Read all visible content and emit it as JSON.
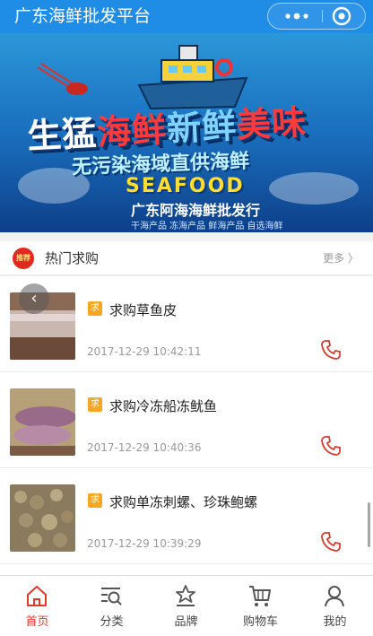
{
  "header": {
    "title": "广东海鲜批发平台"
  },
  "banner": {
    "line1_white": "生猛",
    "line1_red": "海鲜",
    "line1_blue": "新鲜",
    "line1_red2": "美味",
    "line2": "无污染海域直供海鲜",
    "seafood": "SEAFOOD",
    "company": "广东阿海海鲜批发行",
    "categories": "干海产品 冻海产品 鲜海产品 自选海鲜"
  },
  "section": {
    "badge": "推荐",
    "title": "热门求购",
    "more": "更多 〉"
  },
  "items": [
    {
      "tag": "求",
      "name": "求购草鱼皮",
      "time": "2017-12-29 10:42:11"
    },
    {
      "tag": "求",
      "name": "求购冷冻船冻鱿鱼",
      "time": "2017-12-29 10:40:36"
    },
    {
      "tag": "求",
      "name": "求购单冻刺螺、珍珠鲍螺",
      "time": "2017-12-29 10:39:29"
    }
  ],
  "tabs": [
    {
      "label": "首页",
      "icon": "home-icon",
      "active": true
    },
    {
      "label": "分类",
      "icon": "category-icon",
      "active": false
    },
    {
      "label": "品牌",
      "icon": "brand-icon",
      "active": false
    },
    {
      "label": "购物车",
      "icon": "cart-icon",
      "active": false
    },
    {
      "label": "我的",
      "icon": "user-icon",
      "active": false
    }
  ],
  "colors": {
    "header": "#1f8de6",
    "accent": "#e0382d",
    "tag": "#f5a623"
  }
}
